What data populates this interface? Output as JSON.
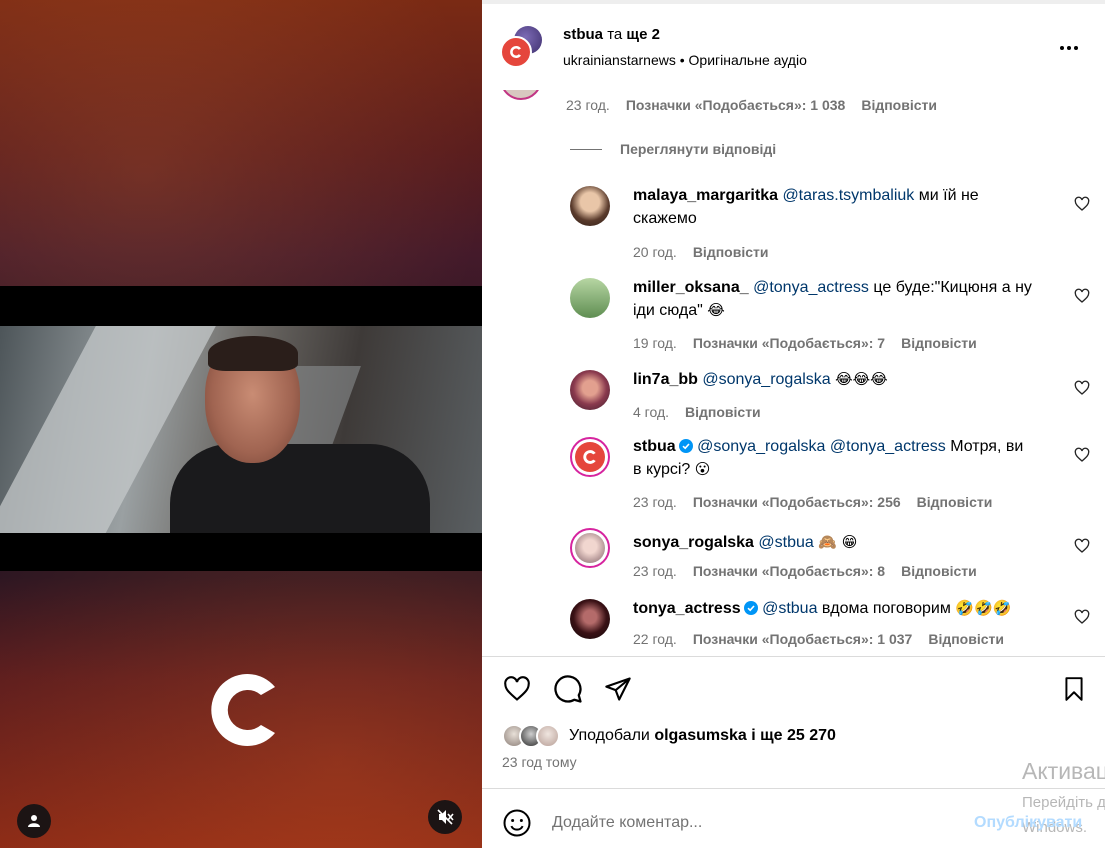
{
  "header": {
    "account": "stbua",
    "and_more": "та",
    "more_count": "ще 2",
    "subline_user": "ukrainianstarnews",
    "subline_sep": "•",
    "audio": "Оригінальне аудіо"
  },
  "first_comment_meta": {
    "time": "23 год.",
    "likes": "Позначки «Подобається»: 1 038",
    "reply": "Відповісти"
  },
  "view_replies": "Переглянути відповіді",
  "replies": [
    {
      "user": "malaya_margaritka",
      "mention": "@taras.tsymbaliuk",
      "text": "ми їй не скажемо",
      "emoji": "",
      "time": "20 год.",
      "likes": "",
      "reply": "Відповісти",
      "verified": false
    },
    {
      "user": "miller_oksana_",
      "mention": "@tonya_actress",
      "text": "це буде:\"Кицюня а ну іди сюда\"",
      "emoji": "😂",
      "time": "19 год.",
      "likes": "Позначки «Подобається»: 7",
      "reply": "Відповісти",
      "verified": false
    },
    {
      "user": "lin7a_bb",
      "mention": "@sonya_rogalska",
      "text": "",
      "emoji": "😂😂😂",
      "time": "4 год.",
      "likes": "",
      "reply": "Відповісти",
      "verified": false
    },
    {
      "user": "stbua",
      "mention": "@sonya_rogalska @tonya_actress",
      "text": "Мотря, ви в курсі?",
      "emoji": "😮",
      "time": "23 год.",
      "likes": "Позначки «Подобається»: 256",
      "reply": "Відповісти",
      "verified": true
    },
    {
      "user": "sonya_rogalska",
      "mention": "@stbua",
      "text": "",
      "emoji": "🙈 😁",
      "time": "23 год.",
      "likes": "Позначки «Подобається»: 8",
      "reply": "Відповісти",
      "verified": false
    },
    {
      "user": "tonya_actress",
      "mention": "@stbua",
      "text": "вдома поговорим",
      "emoji": "🤣🤣🤣",
      "time": "22 год.",
      "likes": "Позначки «Подобається»: 1 037",
      "reply": "Відповісти",
      "verified": true
    }
  ],
  "likes": {
    "prefix": "Уподобали",
    "user": "olgasumska",
    "suffix": "і ще 25 270"
  },
  "time_ago": "23 год тому",
  "comment_input": {
    "placeholder": "Додайте коментар...",
    "publish": "Опублікувати"
  },
  "watermark": {
    "line1": "Активація Windows",
    "line2": "Перейдіть до розділу",
    "line3": "Windows."
  },
  "colors": {
    "mention": "#00376b",
    "meta": "#737373",
    "brand_red": "#e5463c",
    "verified": "#0095f6"
  }
}
